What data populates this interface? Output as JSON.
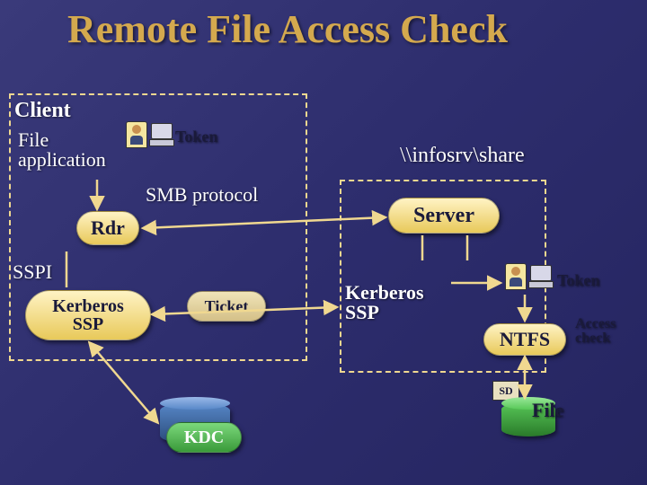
{
  "title": "Remote File Access Check",
  "client": {
    "label": "Client",
    "file_app": "File application",
    "token": "Token",
    "rdr": "Rdr",
    "sspi": "SSPI",
    "kerberos_ssp": "Kerberos SSP"
  },
  "smb_protocol": "SMB protocol",
  "ticket": "Ticket",
  "share_path": "\\\\infosrv\\share",
  "server": {
    "label": "Server",
    "kerberos_ssp": "Kerberos SSP",
    "token": "Token",
    "ntfs": "NTFS",
    "access_check": "Access check",
    "sd": "SD",
    "file": "File"
  },
  "kdc": "KDC"
}
